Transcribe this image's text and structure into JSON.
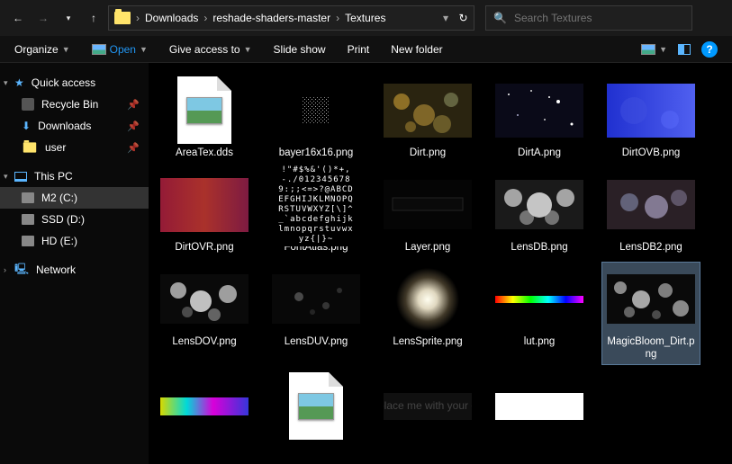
{
  "nav": {
    "back": "←",
    "fwd": "→",
    "recent": "▾",
    "up": "↑"
  },
  "breadcrumb": {
    "c1": "Downloads",
    "c2": "reshade-shaders-master",
    "c3": "Textures"
  },
  "search": {
    "placeholder": "Search Textures"
  },
  "cmd": {
    "organize": "Organize",
    "open": "Open",
    "give": "Give access to",
    "slide": "Slide show",
    "print": "Print",
    "newf": "New folder",
    "help": "?"
  },
  "sidebar": {
    "quick": "Quick access",
    "recycle": "Recycle Bin",
    "downloads": "Downloads",
    "user": "user",
    "thispc": "This PC",
    "m2": "M2 (C:)",
    "ssd": "SSD (D:)",
    "hd": "HD (E:)",
    "network": "Network"
  },
  "files": {
    "f0": "AreaTex.dds",
    "f1": "bayer16x16.png",
    "f2": "Dirt.png",
    "f3": "DirtA.png",
    "f4": "DirtOVB.png",
    "f5": "DirtOVR.png",
    "f6": "FontAtlas.png",
    "f7": "Layer.png",
    "f8": "LensDB.png",
    "f9": "LensDB2.png",
    "f10": "LensDOV.png",
    "f11": "LensDUV.png",
    "f12": "LensSprite.png",
    "f13": "lut.png",
    "f14": "MagicBloom_Dirt.png"
  },
  "fontatlas": " !\"#$%&'()*+,-./0123456789:;;<=>?@ABCDEFGHIJKLMNOPQRSTUVWXYZ[\\]^_`abcdefghijklmnopqrstuvwxyz{|}~"
}
